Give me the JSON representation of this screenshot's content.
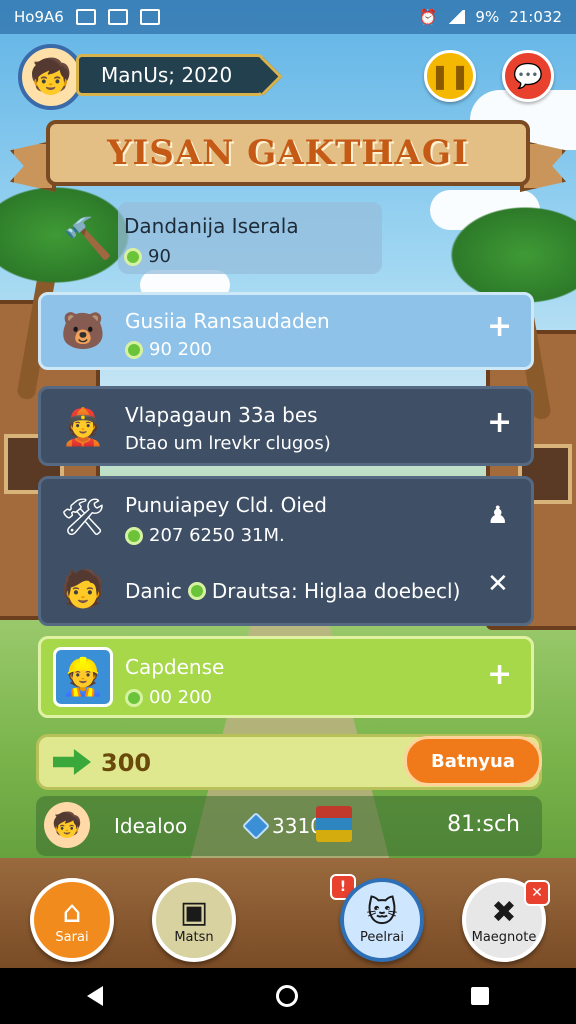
{
  "status_bar": {
    "carrier": "Ho9A6",
    "battery": "9%",
    "time": "21:032"
  },
  "header": {
    "player_name": "ManUs; 2020",
    "title": "YISAN GAKTHAGI"
  },
  "cards": [
    {
      "title": "Dandanija Iserala",
      "value": "90"
    },
    {
      "title": "Gusiia Ransaudaden",
      "value": "90 200"
    },
    {
      "title": "Vlapagaun 33a bes",
      "subtitle": "Dtao um lrevkr clugos)"
    },
    {
      "title": "Punuiapey Cld. Oied",
      "value": "207 6250 31M.",
      "row2_label": "Danic",
      "row2_text": "Drautsa: Higlaa doebecl)"
    },
    {
      "title": "Capdense",
      "value": "00 200"
    }
  ],
  "progress": {
    "amount": "300",
    "button_label": "Batnyua"
  },
  "info_bar": {
    "label": "Idealoo",
    "count": "33104",
    "time": "81:sch"
  },
  "bottom_nav": [
    {
      "label": "Sarai",
      "icon": "home-icon"
    },
    {
      "label": "Matsn",
      "icon": "camera-icon"
    },
    {
      "label": "Peelrai",
      "icon": "pet-icon"
    },
    {
      "label": "Maegnote",
      "icon": "tools-icon"
    }
  ],
  "colors": {
    "accent_orange": "#f07a1a",
    "card_dark": "#3e4f66",
    "card_green": "#a6d84a",
    "card_blue": "#8ec2e8"
  }
}
